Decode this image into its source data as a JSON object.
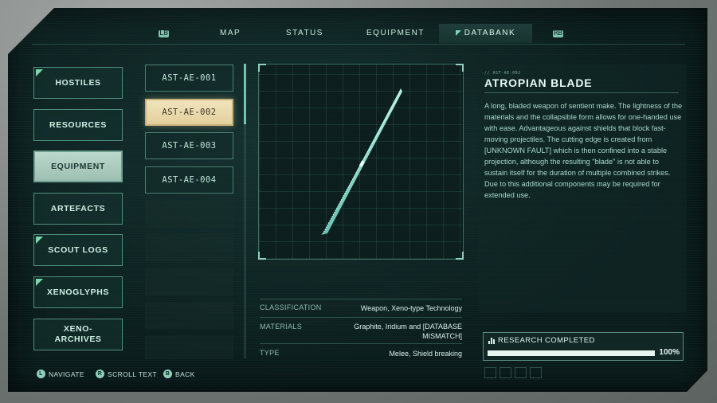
{
  "nav": {
    "left_button": "LB",
    "right_button": "RB",
    "tabs": [
      {
        "label": "MAP"
      },
      {
        "label": "STATUS"
      },
      {
        "label": "EQUIPMENT"
      },
      {
        "label": "DATABANK"
      }
    ],
    "active_tab": "DATABANK"
  },
  "categories": [
    {
      "label": "HOSTILES",
      "new": true
    },
    {
      "label": "RESOURCES",
      "new": false
    },
    {
      "label": "EQUIPMENT",
      "new": false,
      "active": true
    },
    {
      "label": "ARTEFACTS",
      "new": false
    },
    {
      "label": "SCOUT LOGS",
      "new": true
    },
    {
      "label": "XENOGLYPHS",
      "new": true
    },
    {
      "label": "XENO-\nARCHIVES",
      "new": false
    }
  ],
  "entries": [
    {
      "label": "AST-AE-001"
    },
    {
      "label": "AST-AE-002",
      "active": true
    },
    {
      "label": "AST-AE-003"
    },
    {
      "label": "AST-AE-004"
    }
  ],
  "stats": [
    {
      "label": "CLASSIFICATION",
      "value": "Weapon, Xeno-type Technology"
    },
    {
      "label": "MATERIALS",
      "value": "Graphite, Iridium and [DATABASE MISMATCH]"
    },
    {
      "label": "TYPE",
      "value": "Melee, Shield breaking"
    }
  ],
  "detail": {
    "tag": "// AST-AE-002",
    "title": "ATROPIAN BLADE",
    "description": "A long, bladed weapon of sentient make. The lightness of the materials and the collapsible form allows for one-handed use with ease. Advantageous against shields that block fast-moving projectiles. The cutting edge is created from [UNKNOWN FAULT] which is then confined into a stable projection, although the resulting \"blade\" is not able to sustain itself for the duration of multiple combined strikes. Due to this additional components may be required for extended use."
  },
  "research": {
    "label": "RESEARCH COMPLETED",
    "percent_text": "100%",
    "progress": 1.0
  },
  "footer": [
    {
      "key": "L",
      "label": "NAVIGATE"
    },
    {
      "key": "R",
      "label": "SCROLL TEXT"
    },
    {
      "key": "B",
      "label": "BACK"
    }
  ],
  "colors": {
    "accent": "#7fc2ae",
    "selected_entry": "#e8d8a8",
    "selected_category": "#b0cfc3",
    "background": "#0b1d1d"
  }
}
